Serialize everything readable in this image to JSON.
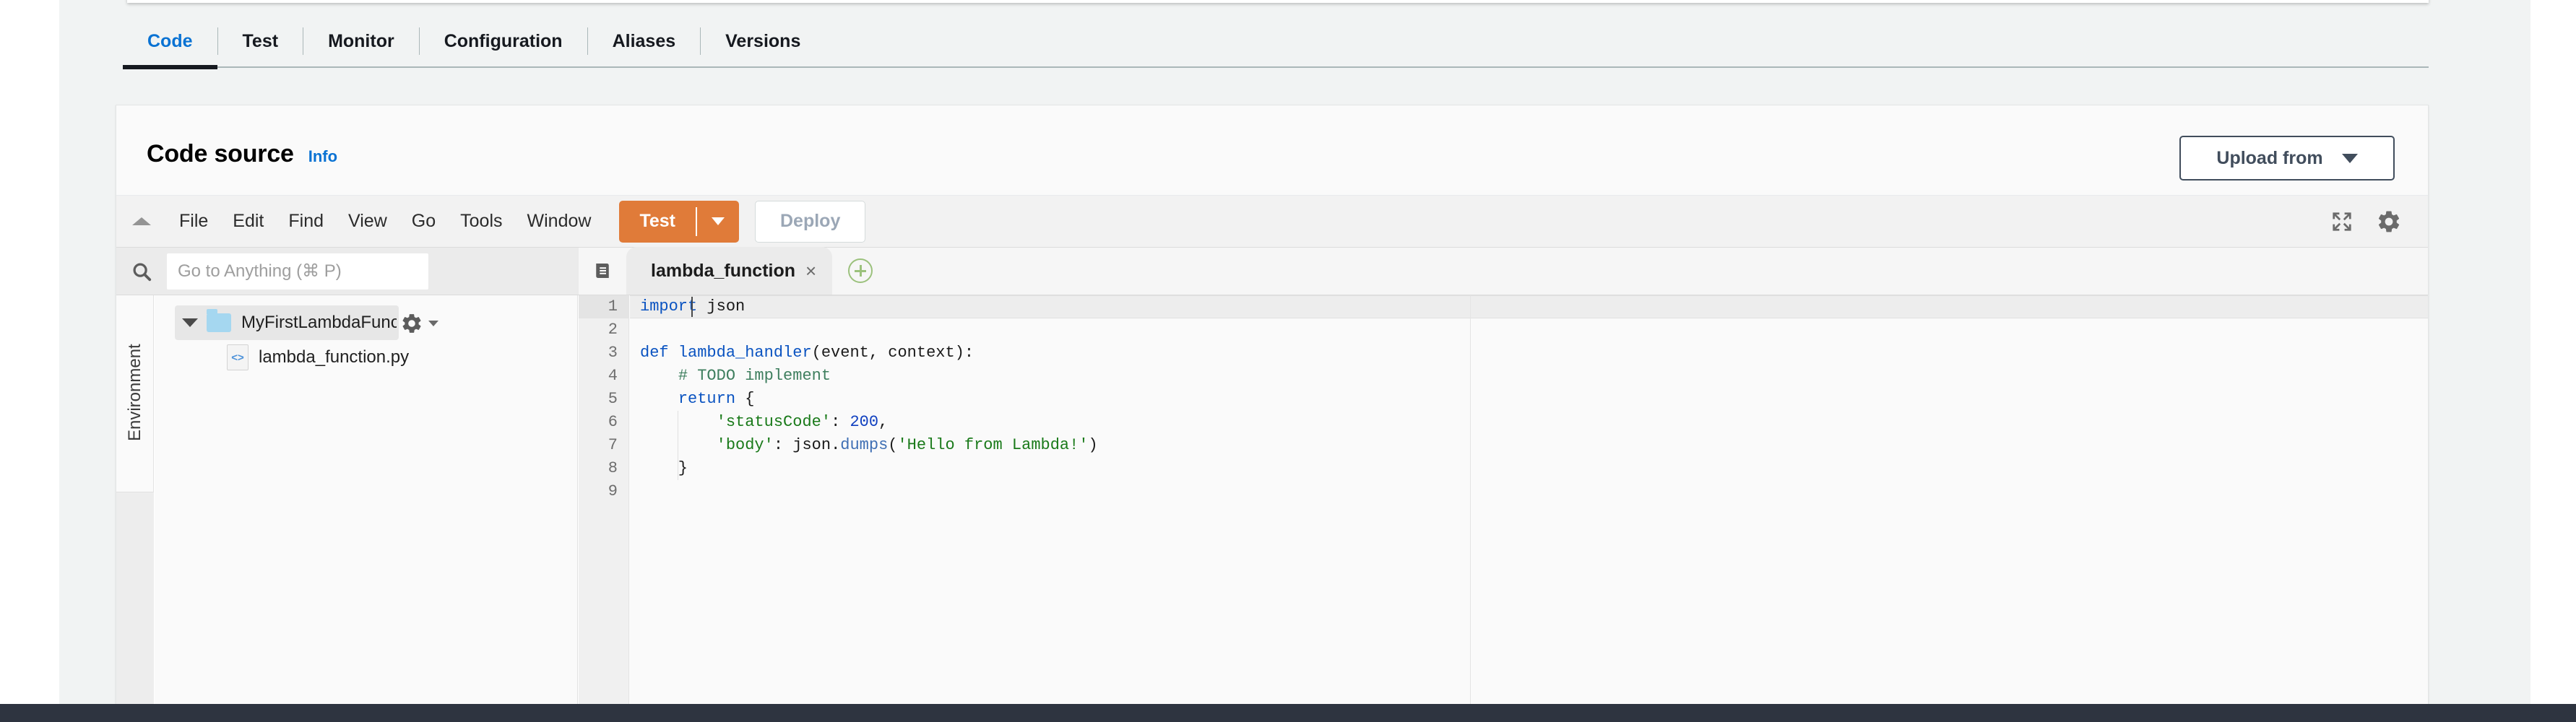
{
  "service_tabs": [
    {
      "label": "Code",
      "selected": true
    },
    {
      "label": "Test",
      "selected": false
    },
    {
      "label": "Monitor",
      "selected": false
    },
    {
      "label": "Configuration",
      "selected": false
    },
    {
      "label": "Aliases",
      "selected": false
    },
    {
      "label": "Versions",
      "selected": false
    }
  ],
  "card": {
    "title": "Code source",
    "info_link": "Info",
    "upload_button": "Upload from",
    "upload_caret": "chevron-down-icon"
  },
  "ide": {
    "collapse_icon": "triangle-up-icon",
    "menus": [
      "File",
      "Edit",
      "Find",
      "View",
      "Go",
      "Tools",
      "Window"
    ],
    "test_button": "Test",
    "test_dropdown_icon": "chevron-down-icon",
    "deploy_button": "Deploy",
    "fullscreen_icon": "expand-icon",
    "settings_icon": "gear-icon"
  },
  "search": {
    "icon": "search-icon",
    "placeholder": "Go to Anything (⌘ P)",
    "value": ""
  },
  "editor_tabs": {
    "panel_icon": "file-list-icon",
    "tabs": [
      {
        "label": "lambda_function",
        "close": "×",
        "active": true
      }
    ],
    "add_tab_icon": "plus-circle-icon"
  },
  "explorer": {
    "rail_label": "Environment",
    "folder": {
      "name": "MyFirstLambdaFunc",
      "expanded": true,
      "gear_icon": "gear-icon"
    },
    "files": [
      {
        "name": "lambda_function.py",
        "icon": "code-file-icon"
      }
    ]
  },
  "code": {
    "language": "python",
    "active_line": 1,
    "line_numbers": [
      "1",
      "2",
      "3",
      "4",
      "5",
      "6",
      "7",
      "8",
      "9"
    ],
    "lines": [
      {
        "n": 1,
        "text": "import json"
      },
      {
        "n": 2,
        "text": ""
      },
      {
        "n": 3,
        "text": "def lambda_handler(event, context):"
      },
      {
        "n": 4,
        "text": "    # TODO implement"
      },
      {
        "n": 5,
        "text": "    return {"
      },
      {
        "n": 6,
        "text": "        'statusCode': 200,"
      },
      {
        "n": 7,
        "text": "        'body': json.dumps('Hello from Lambda!')"
      },
      {
        "n": 8,
        "text": "    }"
      },
      {
        "n": 9,
        "text": ""
      }
    ]
  },
  "colors": {
    "accent_blue": "#0972d3",
    "test_orange": "#e07b39",
    "canvas_grey": "#f1f3f3",
    "footer_navy": "#2e3440",
    "keyword_blue": "#0a53c1",
    "string_green": "#1a7a1a",
    "comment_green": "#3f7f5f"
  }
}
